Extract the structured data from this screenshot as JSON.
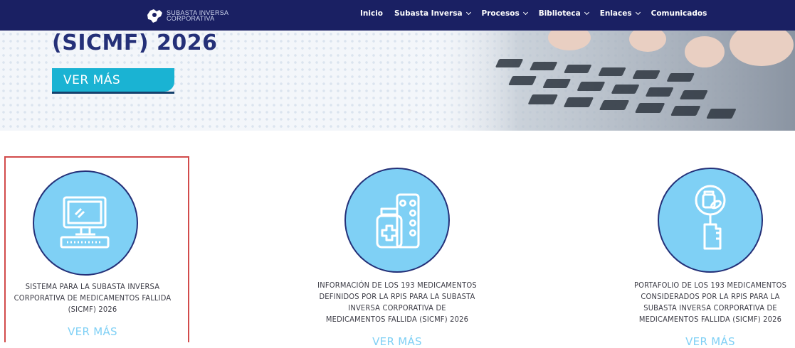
{
  "logo": {
    "line1": "SUBASTA INVERSA",
    "line2": "CORPORATIVA",
    "icon": "ecuador-map-logo-icon"
  },
  "nav": {
    "items": [
      {
        "label": "Inicio",
        "dropdown": false
      },
      {
        "label": "Subasta Inversa",
        "dropdown": true
      },
      {
        "label": "Procesos",
        "dropdown": true
      },
      {
        "label": "Biblioteca",
        "dropdown": true
      },
      {
        "label": "Enlaces",
        "dropdown": true
      },
      {
        "label": "Comunicados",
        "dropdown": false
      }
    ]
  },
  "hero": {
    "title": "(SICMF) 2026",
    "button": "VER MÁS"
  },
  "cards": [
    {
      "icon": "computer-monitor-icon",
      "lines": [
        "SISTEMA PARA LA SUBASTA INVERSA",
        "CORPORATIVA DE MEDICAMENTOS FALLIDA",
        "(SICMF) 2026"
      ],
      "link": "VER MÁS"
    },
    {
      "icon": "medicine-pills-icon",
      "lines": [
        "INFORMACIÓN DE LOS 193 MEDICAMENTOS",
        "DEFINIDOS POR LA RPIS PARA LA SUBASTA",
        "INVERSA CORPORATIVA DE",
        "MEDICAMENTOS FALLIDA (SICMF) 2026"
      ],
      "link": "VER MÁS"
    },
    {
      "icon": "magnifier-medicine-icon",
      "lines": [
        "PORTAFOLIO DE LOS 193 MEDICAMENTOS",
        "CONSIDERADOS POR LA RPIS PARA LA",
        "SUBASTA INVERSA CORPORATIVA DE",
        "MEDICAMENTOS FALLIDA (SICMF) 2026"
      ],
      "link": "VER MÁS"
    }
  ],
  "colors": {
    "nav_bg": "#1a2063",
    "accent_cyan": "#1ab3d3",
    "circle_fill": "#7fd0f5",
    "circle_stroke": "#243078",
    "selected_border": "#d24b4b"
  }
}
